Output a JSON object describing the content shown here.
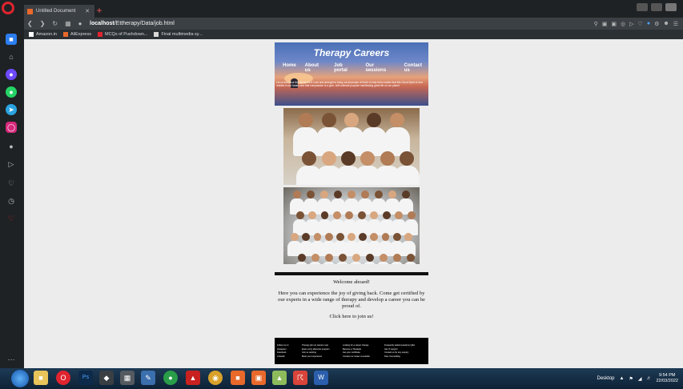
{
  "browser": {
    "tab_title": "Untitled Document",
    "tab_close": "✕",
    "new_tab": "+",
    "url_host": "localhost",
    "url_path": "/Ettherapy/Data/job.html",
    "bookmarks": [
      "Amazon.in",
      "AliExpress",
      "MCQs of Pushdown...",
      "Final multimedia sy..."
    ],
    "bookmark_colors": [
      "#ffffff",
      "#e8692b",
      "#e0242f",
      "#d8d8d8"
    ]
  },
  "site": {
    "title": "Therapy Careers",
    "nav": [
      "Home",
      "About us",
      "Job portal",
      "Our sessions",
      "Contact us"
    ],
    "banner_text": "Let us introduce the Great Art of Love and strength to bring out all people of Earth to help them realise that this Great Spirit of love resides in our hearts and that compassion is a gem, with ultimate purpose manifesting great life on our planet",
    "welcome": "Welcome aboard!",
    "description": "Here you can experience the joy of giving back. Come get certified by our experts in a wide range of therapy and develop a career you can be proud of.",
    "join": "Click here to join us!",
    "footer_columns": [
      [
        "Follow us on",
        "Instagram",
        "Facebook",
        "LinkedIn"
      ],
      [
        "Therapy job our careers now",
        "Exam entry aftercare program",
        "Join us working",
        "Book your experience"
      ],
      [
        "Looking for a career change",
        "Become a Therapist",
        "Get your certificate",
        "Contact our career counsellor"
      ],
      [
        "Frequently asked questions Q&A",
        "Get IT support",
        "Contact us for any enquiry",
        "Peer Counselling"
      ]
    ]
  },
  "taskbar": {
    "desktop_label": "Desktop",
    "time": "9:54 PM",
    "date": "22/03/2022"
  },
  "colors": {
    "accent": "#e0242f",
    "chrome_dark": "#1e2224",
    "viewport_bg": "#ececec"
  }
}
